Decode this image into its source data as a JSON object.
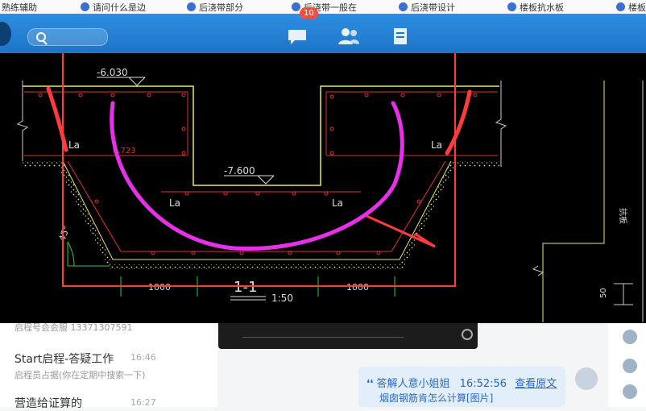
{
  "tabs": [
    "熟练辅助",
    "请问什么是边",
    "后浇带部分",
    "后浇带一般在",
    "后浇带设计",
    "楼板抗水板",
    "楼板"
  ],
  "header": {
    "badge_count": "10",
    "icons": [
      "search-icon",
      "chat-icon",
      "contacts-icon",
      "documents-icon"
    ]
  },
  "chat_list": [
    {
      "title": "",
      "subtitle": "启程号会会服 13371307591",
      "time": ""
    },
    {
      "title": "Start启程-答疑工作",
      "subtitle": "启程员占据(你在定期中搜索一下)",
      "time": "16:46"
    },
    {
      "title": "营造给证算的",
      "subtitle": "",
      "time": "16:27"
    }
  ],
  "message": {
    "sender": "答解人意小姐姐",
    "time": "16:52:56",
    "link": "查看原文",
    "text": "烟囱钢筋肯怎么计算[图片]"
  },
  "drawing": {
    "elev_top": "-6.030",
    "elev_pit": "-7.600",
    "dim_width": "0.723",
    "la_label": "La",
    "angle": "45°",
    "dim_left": "1000",
    "dim_right": "1000",
    "section_title": "1-1",
    "scale": "1:50",
    "side_note": "抗板",
    "dim_fifty": "50"
  },
  "colors": {
    "header_blue": "#1d74c8",
    "cad_bg": "#000000",
    "highlight_red": "#ff3b3b",
    "annotation_magenta": "#e830e8"
  }
}
